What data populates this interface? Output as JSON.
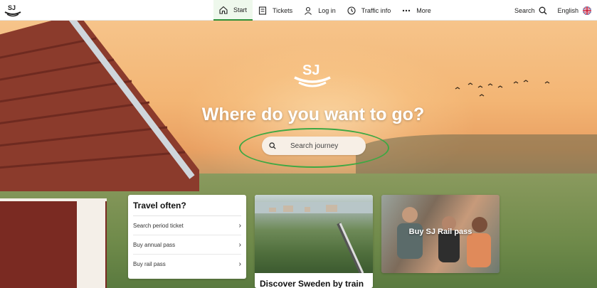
{
  "header": {
    "logo_text": "SJ",
    "nav": [
      {
        "label": "Start",
        "icon": "home-icon",
        "active": true
      },
      {
        "label": "Tickets",
        "icon": "ticket-icon",
        "active": false
      },
      {
        "label": "Log in",
        "icon": "user-icon",
        "active": false
      },
      {
        "label": "Traffic info",
        "icon": "clock-icon",
        "active": false
      },
      {
        "label": "More",
        "icon": "more-dots-icon",
        "active": false
      }
    ],
    "search_label": "Search",
    "language_label": "English"
  },
  "hero": {
    "headline": "Where do you want to go?",
    "search_placeholder": "Search journey",
    "highlight_color": "#3da843"
  },
  "travel_often": {
    "title": "Travel often?",
    "items": [
      {
        "label": "Search period ticket"
      },
      {
        "label": "Buy annual pass"
      },
      {
        "label": "Buy rail pass"
      }
    ]
  },
  "discover_card": {
    "title": "Discover Sweden by train"
  },
  "rail_pass_card": {
    "title": "Buy SJ Rail pass"
  },
  "colors": {
    "accent_green": "#2f8f3a",
    "active_tab_bg": "#eef8ec"
  }
}
